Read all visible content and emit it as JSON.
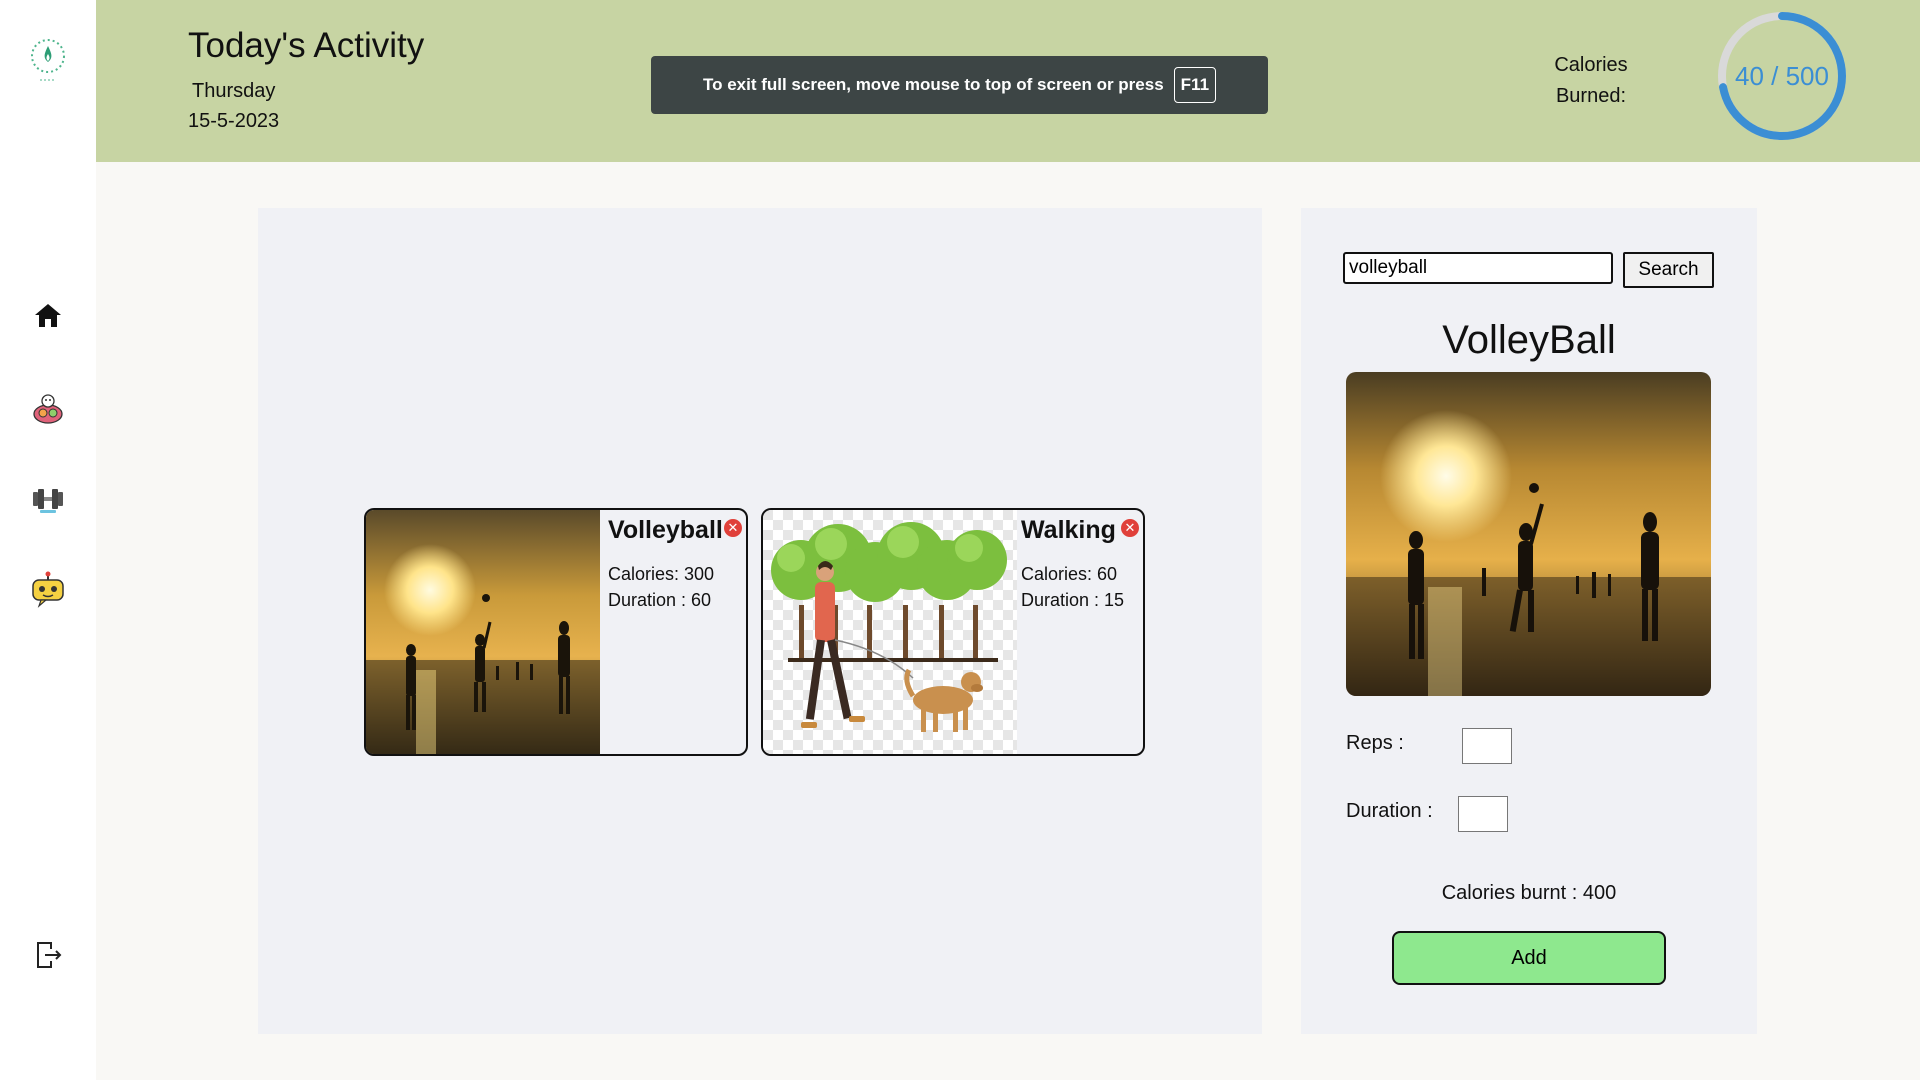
{
  "header": {
    "title": "Today's Activity",
    "weekday": "Thursday",
    "date": "15-5-2023",
    "calories_label": "Calories Burned:",
    "calories_progress": "40 / 500",
    "calories_current": 40,
    "calories_goal": 500
  },
  "fullscreen_banner": {
    "text": "To exit full screen, move mouse to top of screen or press",
    "key": "F11"
  },
  "sidebar": {
    "items": [
      {
        "icon": "home-icon"
      },
      {
        "icon": "food-icon"
      },
      {
        "icon": "dumbbell-icon"
      },
      {
        "icon": "robot-icon"
      },
      {
        "icon": "logout-icon"
      }
    ]
  },
  "activities": [
    {
      "name": "Volleyball",
      "calories": "Calories: 300",
      "duration": "Duration : 60"
    },
    {
      "name": "Walking",
      "calories": "Calories: 60",
      "duration": "Duration : 15"
    }
  ],
  "search": {
    "value": "volleyball",
    "button": "Search"
  },
  "detail": {
    "title": "VolleyBall",
    "reps_label": "Reps :",
    "duration_label": "Duration :",
    "calories_burnt": "Calories burnt : 400",
    "add_label": "Add"
  },
  "colors": {
    "header_bg": "#c7d4a3",
    "gauge_blue": "#3b8ed4",
    "add_button": "#8ee88e",
    "close_red": "#e0403a"
  }
}
